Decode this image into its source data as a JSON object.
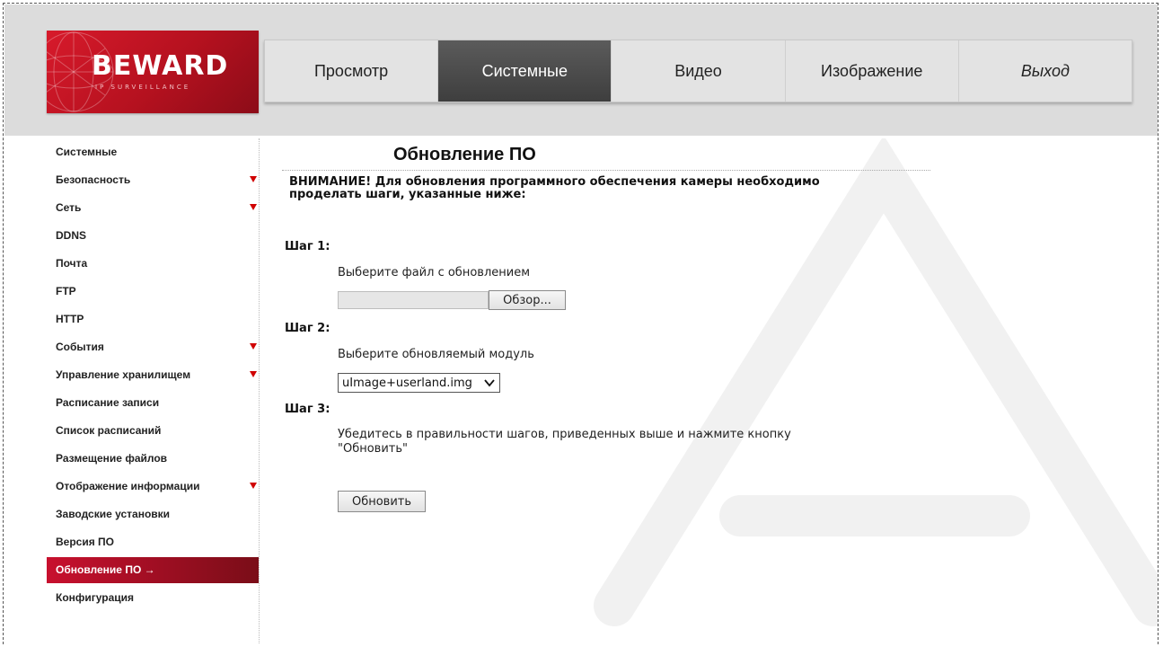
{
  "logo": {
    "brand": "BEWARD",
    "tagline": "IP SURVEILLANCE"
  },
  "nav": {
    "tabs": [
      {
        "label": "Просмотр"
      },
      {
        "label": "Системные"
      },
      {
        "label": "Видео"
      },
      {
        "label": "Изображение"
      },
      {
        "label": "Выход"
      }
    ],
    "active": "Системные"
  },
  "sidebar": {
    "items": [
      {
        "label": "Системные"
      },
      {
        "label": "Безопасность",
        "has_submenu": true
      },
      {
        "label": "Сеть",
        "has_submenu": true
      },
      {
        "label": "DDNS"
      },
      {
        "label": "Почта"
      },
      {
        "label": "FTP"
      },
      {
        "label": "HTTP"
      },
      {
        "label": "События",
        "has_submenu": true
      },
      {
        "label": "Управление хранилищем",
        "has_submenu": true
      },
      {
        "label": "Расписание записи"
      },
      {
        "label": "Список расписаний"
      },
      {
        "label": "Размещение файлов"
      },
      {
        "label": "Отображение информации",
        "has_submenu": true
      },
      {
        "label": "Заводские установки"
      },
      {
        "label": "Версия ПО"
      },
      {
        "label": "Обновление ПО →",
        "active": true
      },
      {
        "label": "Конфигурация"
      }
    ]
  },
  "main": {
    "title": "Обновление ПО",
    "warning_line1": "ВНИМАНИЕ! Для обновления программного обеспечения камеры необходимо",
    "warning_line2": "проделать шаги, указанные ниже:",
    "step1": {
      "label": "Шаг 1:",
      "instruction": "Выберите файл с обновлением",
      "browse_label": "Обзор...",
      "file_value": ""
    },
    "step2": {
      "label": "Шаг 2:",
      "instruction": "Выберите обновляемый модуль",
      "selected_module": "uImage+userland.img"
    },
    "step3": {
      "label": "Шаг 3:",
      "instruction_line1": "Убедитесь в правильности шагов, приведенных выше и нажмите кнопку",
      "instruction_line2": "\"Обновить\""
    },
    "update_label": "Обновить"
  },
  "colors": {
    "brand_red": "#c8102e",
    "active_tab": "#4a4a4a",
    "submenu_arrow": "#d00000"
  }
}
